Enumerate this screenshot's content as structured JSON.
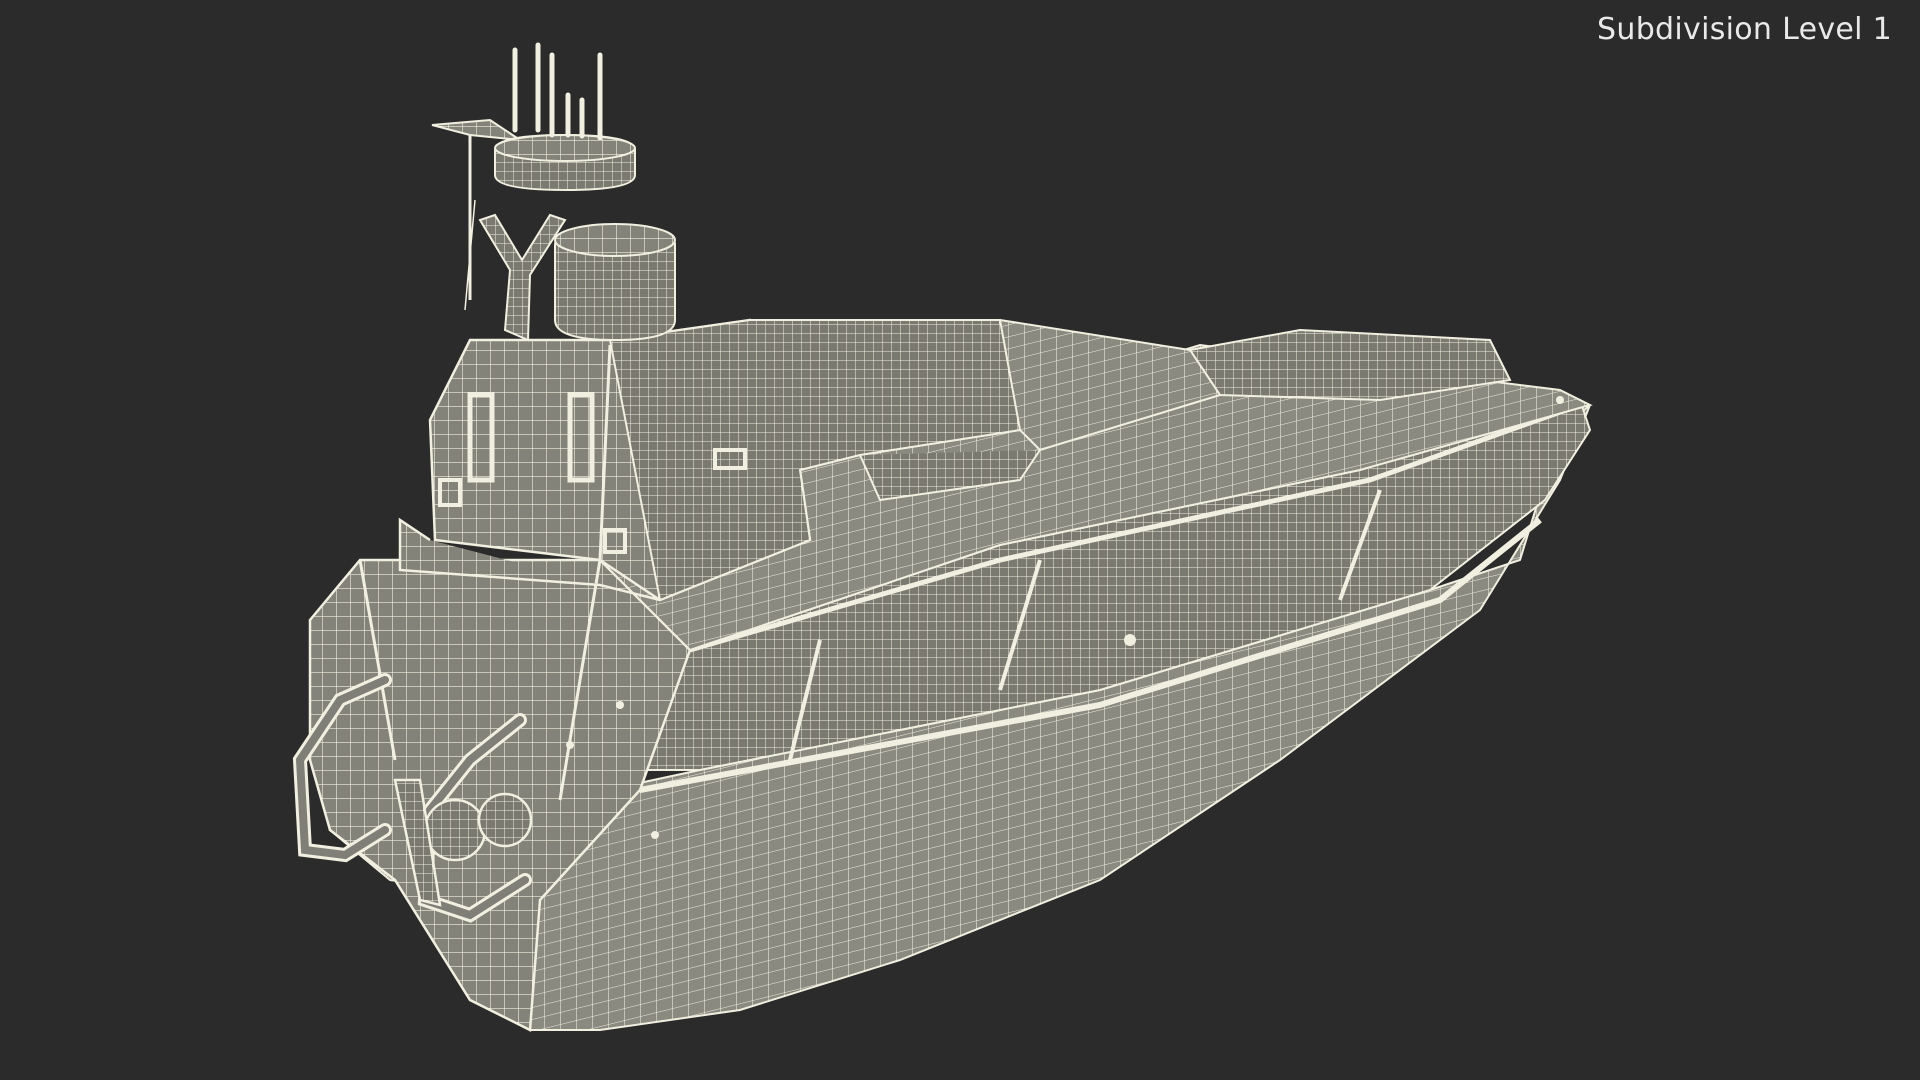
{
  "viewport": {
    "label": "Subdivision Level 1"
  },
  "colors": {
    "background": "#2b2b2b",
    "mesh_fill": "#7f7f78",
    "mesh_wire": "#f1efdf",
    "mesh_shadow": "#5f5f59"
  },
  "model": {
    "icon": "wireframe-boat-model"
  }
}
